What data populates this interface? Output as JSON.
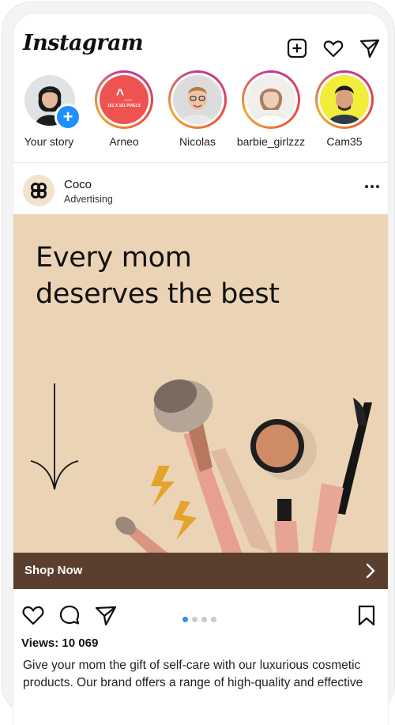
{
  "app": {
    "logo_text": "Instagram"
  },
  "header": {
    "icons": [
      "add-post-icon",
      "heart-icon",
      "send-icon"
    ]
  },
  "stories": [
    {
      "label": "Your story",
      "kind": "own"
    },
    {
      "label": "Arneo",
      "kind": "ring",
      "logo_text": "161 X 161 PIXELS",
      "logo_mark": "^_"
    },
    {
      "label": "Nicolas",
      "kind": "ring"
    },
    {
      "label": "barbie_girlzzz",
      "kind": "ring"
    },
    {
      "label": "Cam35",
      "kind": "ring"
    }
  ],
  "post": {
    "author": "Coco",
    "subtitle": "Advertising",
    "headline_line1": "Every mom",
    "headline_line2": "deserves the best",
    "cta": "Shop Now",
    "views": "Views: 10 069",
    "caption": "Give your mom the gift of self-care with our luxurious cosmetic products. Our brand offers a range of high-quality and effective"
  },
  "carousel": {
    "count": 4,
    "active": 1
  },
  "colors": {
    "ad_background": "#ebd4b6",
    "cta_bar": "#5b3f2e",
    "accent_blue": "#2f8ef4",
    "story_ring": "#c0359a"
  }
}
